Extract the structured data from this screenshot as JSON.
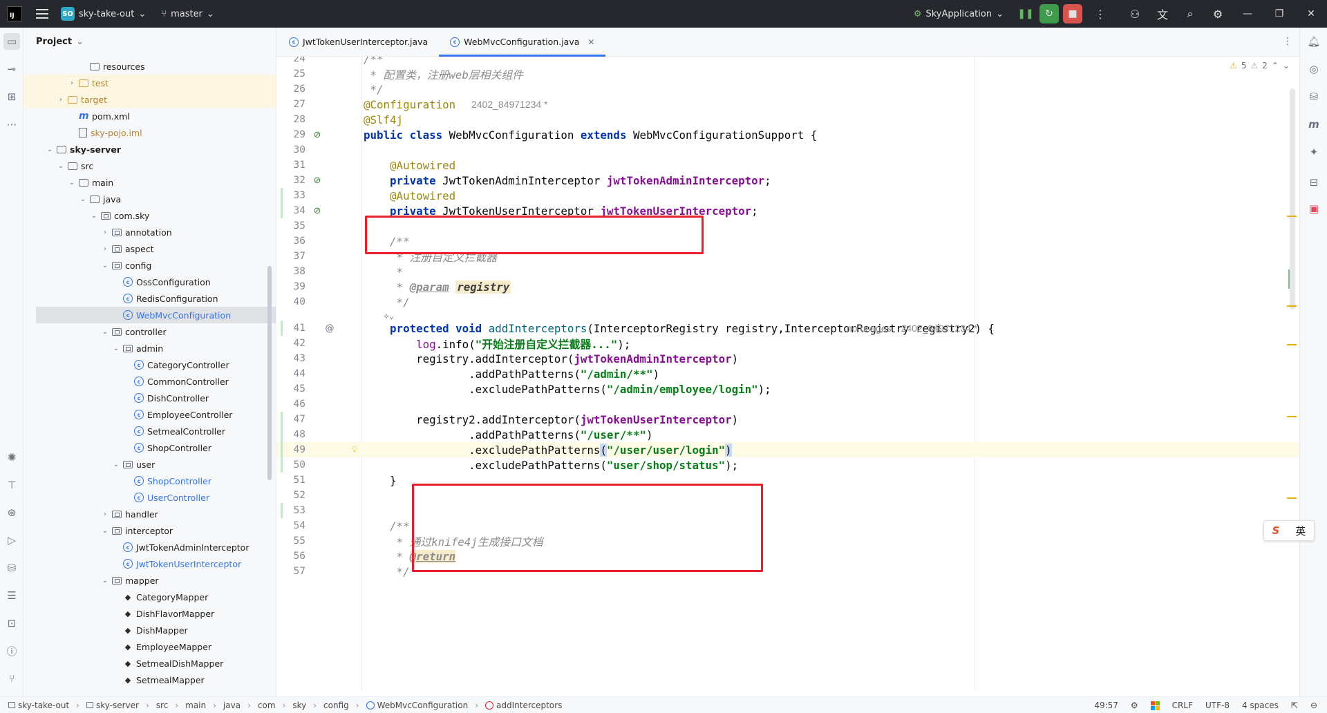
{
  "titlebar": {
    "project_badge": "SO",
    "project_name": "sky-take-out",
    "branch": "master",
    "run_config": "SkyApplication"
  },
  "project_panel": {
    "title": "Project",
    "tree": [
      {
        "label": "resources",
        "depth": 5,
        "arrow": "",
        "icon": "folder-ico",
        "style": ""
      },
      {
        "label": "test",
        "depth": 4,
        "arrow": "›",
        "icon": "folder-ico orange",
        "style": "t-orange",
        "row": "hl-yellow"
      },
      {
        "label": "target",
        "depth": 3,
        "arrow": "›",
        "icon": "folder-ico orange",
        "style": "t-orange",
        "row": "hl-yellow"
      },
      {
        "label": "pom.xml",
        "depth": 4,
        "arrow": "",
        "icon": "m-ico",
        "style": ""
      },
      {
        "label": "sky-pojo.iml",
        "depth": 4,
        "arrow": "",
        "icon": "file-ico",
        "style": "t-orange"
      },
      {
        "label": "sky-server",
        "depth": 2,
        "arrow": "⌄",
        "icon": "folder-ico",
        "style": "t-bold"
      },
      {
        "label": "src",
        "depth": 3,
        "arrow": "⌄",
        "icon": "folder-ico",
        "style": ""
      },
      {
        "label": "main",
        "depth": 4,
        "arrow": "⌄",
        "icon": "folder-ico",
        "style": ""
      },
      {
        "label": "java",
        "depth": 5,
        "arrow": "⌄",
        "icon": "folder-ico",
        "style": ""
      },
      {
        "label": "com.sky",
        "depth": 6,
        "arrow": "⌄",
        "icon": "folder-ico pkg",
        "style": ""
      },
      {
        "label": "annotation",
        "depth": 7,
        "arrow": "›",
        "icon": "folder-ico pkg",
        "style": ""
      },
      {
        "label": "aspect",
        "depth": 7,
        "arrow": "›",
        "icon": "folder-ico pkg",
        "style": ""
      },
      {
        "label": "config",
        "depth": 7,
        "arrow": "⌄",
        "icon": "folder-ico pkg",
        "style": ""
      },
      {
        "label": "OssConfiguration",
        "depth": 8,
        "arrow": "",
        "icon": "class-ico",
        "style": ""
      },
      {
        "label": "RedisConfiguration",
        "depth": 8,
        "arrow": "",
        "icon": "class-ico",
        "style": ""
      },
      {
        "label": "WebMvcConfiguration",
        "depth": 8,
        "arrow": "",
        "icon": "class-ico",
        "style": "t-blue",
        "row": "selected"
      },
      {
        "label": "controller",
        "depth": 7,
        "arrow": "⌄",
        "icon": "folder-ico pkg",
        "style": ""
      },
      {
        "label": "admin",
        "depth": 8,
        "arrow": "⌄",
        "icon": "folder-ico pkg",
        "style": ""
      },
      {
        "label": "CategoryController",
        "depth": 9,
        "arrow": "",
        "icon": "class-ico",
        "style": ""
      },
      {
        "label": "CommonController",
        "depth": 9,
        "arrow": "",
        "icon": "class-ico",
        "style": ""
      },
      {
        "label": "DishController",
        "depth": 9,
        "arrow": "",
        "icon": "class-ico",
        "style": ""
      },
      {
        "label": "EmployeeController",
        "depth": 9,
        "arrow": "",
        "icon": "class-ico",
        "style": ""
      },
      {
        "label": "SetmealController",
        "depth": 9,
        "arrow": "",
        "icon": "class-ico",
        "style": ""
      },
      {
        "label": "ShopController",
        "depth": 9,
        "arrow": "",
        "icon": "class-ico",
        "style": ""
      },
      {
        "label": "user",
        "depth": 8,
        "arrow": "⌄",
        "icon": "folder-ico pkg",
        "style": ""
      },
      {
        "label": "ShopController",
        "depth": 9,
        "arrow": "",
        "icon": "class-ico",
        "style": "t-blue"
      },
      {
        "label": "UserController",
        "depth": 9,
        "arrow": "",
        "icon": "class-ico",
        "style": "t-blue"
      },
      {
        "label": "handler",
        "depth": 7,
        "arrow": "›",
        "icon": "folder-ico pkg",
        "style": ""
      },
      {
        "label": "interceptor",
        "depth": 7,
        "arrow": "⌄",
        "icon": "folder-ico pkg",
        "style": ""
      },
      {
        "label": "JwtTokenAdminInterceptor",
        "depth": 8,
        "arrow": "",
        "icon": "class-ico",
        "style": ""
      },
      {
        "label": "JwtTokenUserInterceptor",
        "depth": 8,
        "arrow": "",
        "icon": "class-ico",
        "style": "t-blue"
      },
      {
        "label": "mapper",
        "depth": 7,
        "arrow": "⌄",
        "icon": "folder-ico pkg",
        "style": ""
      },
      {
        "label": "CategoryMapper",
        "depth": 8,
        "arrow": "",
        "icon": "mapper-ico",
        "style": ""
      },
      {
        "label": "DishFlavorMapper",
        "depth": 8,
        "arrow": "",
        "icon": "mapper-ico",
        "style": ""
      },
      {
        "label": "DishMapper",
        "depth": 8,
        "arrow": "",
        "icon": "mapper-ico",
        "style": ""
      },
      {
        "label": "EmployeeMapper",
        "depth": 8,
        "arrow": "",
        "icon": "mapper-ico",
        "style": ""
      },
      {
        "label": "SetmealDishMapper",
        "depth": 8,
        "arrow": "",
        "icon": "mapper-ico",
        "style": ""
      },
      {
        "label": "SetmealMapper",
        "depth": 8,
        "arrow": "",
        "icon": "mapper-ico",
        "style": ""
      }
    ]
  },
  "tabs": [
    {
      "label": "JwtTokenUserInterceptor.java",
      "active": false
    },
    {
      "label": "WebMvcConfiguration.java",
      "active": true
    }
  ],
  "editor": {
    "inspections": {
      "warnings": "5",
      "weak_warnings": "2"
    },
    "author_hint": "2402_84971234 *",
    "no_usages": "no usages",
    "lines": [
      {
        "n": "24",
        "html": "<span class=\"cm\">/**</span>"
      },
      {
        "n": "25",
        "html": "<span class=\"cm\"> * 配置类，注册web层相关组件</span>"
      },
      {
        "n": "26",
        "html": "<span class=\"cm\"> */</span>"
      },
      {
        "n": "27",
        "html": "<span class=\"ann\">@Configuration</span>",
        "hint": "author"
      },
      {
        "n": "28",
        "html": "<span class=\"ann\">@Slf4j</span>"
      },
      {
        "n": "29",
        "html": "<span class=\"kw\">public class</span> WebMvcConfiguration <span class=\"kw\">extends</span> WebMvcConfigurationSupport {",
        "mark": "bean"
      },
      {
        "n": "30",
        "html": ""
      },
      {
        "n": "31",
        "html": "    <span class=\"ann\">@Autowired</span>"
      },
      {
        "n": "32",
        "html": "    <span class=\"kw\">private</span> JwtTokenAdminInterceptor <span class=\"fld\">jwtTokenAdminInterceptor</span>;",
        "mark": "bean"
      },
      {
        "n": "33",
        "html": "    <span class=\"ann\">@Autowired</span>",
        "changed": true
      },
      {
        "n": "34",
        "html": "    <span class=\"kw\">private</span> JwtTokenUserInterceptor <span class=\"fld\">jwtTokenUserInterceptor</span>;",
        "mark": "bean",
        "changed": true
      },
      {
        "n": "35",
        "html": ""
      },
      {
        "n": "36",
        "html": "    <span class=\"cm\">/**</span>"
      },
      {
        "n": "37",
        "html": "    <span class=\"cm\"> * 注册自定义拦截器</span>"
      },
      {
        "n": "38",
        "html": "    <span class=\"cm\"> *</span>"
      },
      {
        "n": "39",
        "html": "    <span class=\"cm\"> * </span><span class=\"doctag\">@param</span> <span class=\"param\">registry</span>"
      },
      {
        "n": "40",
        "html": "    <span class=\"cm\"> */</span>"
      },
      {
        "n": "",
        "html": "    <span class=\"dim\">⟡⌄</span>",
        "small": true
      },
      {
        "n": "41",
        "html": "    <span class=\"kw\">protected void</span> <span class=\"mth\">addInterceptors</span>(InterceptorRegistry registry,InterceptorRegistry registry2) {",
        "mark": "at",
        "hint": "usages",
        "changed": true
      },
      {
        "n": "42",
        "html": "        <span class=\"fld\" style=\"font-weight:normal\">log</span>.info(<span class=\"str\">\"开始注册自定义拦截器...\"</span>);"
      },
      {
        "n": "43",
        "html": "        registry.addInterceptor(<span class=\"fld\">jwtTokenAdminInterceptor</span>)"
      },
      {
        "n": "44",
        "html": "                .addPathPatterns(<span class=\"str\">\"/admin/**\"</span>)"
      },
      {
        "n": "45",
        "html": "                .excludePathPatterns(<span class=\"str\">\"/admin/employee/login\"</span>);"
      },
      {
        "n": "46",
        "html": ""
      },
      {
        "n": "47",
        "html": "        registry2.addInterceptor(<span class=\"fld\">jwtTokenUserInterceptor</span>)",
        "changed": true
      },
      {
        "n": "48",
        "html": "                .addPathPatterns(<span class=\"str\">\"/user/**\"</span>)",
        "changed": true
      },
      {
        "n": "49",
        "html": "                .excludePathPatterns<span class=\"brace-hl\">(</span><span class=\"str\">\"/user/user/login\"</span><span class=\"brace-hl\">)</span>",
        "mark": "bulb",
        "caret": true,
        "changed": true
      },
      {
        "n": "50",
        "html": "                .excludePathPatterns(<span class=\"str\">\"user/shop/status\"</span>);",
        "changed": true
      },
      {
        "n": "51",
        "html": "    }"
      },
      {
        "n": "52",
        "html": ""
      },
      {
        "n": "53",
        "html": "",
        "changed": true
      },
      {
        "n": "54",
        "html": "    <span class=\"cm\">/**</span>"
      },
      {
        "n": "55",
        "html": "    <span class=\"cm\"> * 通过knife4j生成接口文档</span>"
      },
      {
        "n": "56",
        "html": "    <span class=\"cm\"> * </span><span class=\"doctag\" style=\"background:#f6eccc\">@return</span>"
      },
      {
        "n": "57",
        "html": "    <span class=\"cm\"> */</span>"
      }
    ]
  },
  "ime": {
    "brand": "S",
    "mode": "英"
  },
  "statusbar": {
    "breadcrumbs": [
      "sky-take-out",
      "sky-server",
      "src",
      "main",
      "java",
      "com",
      "sky",
      "config",
      "WebMvcConfiguration",
      "addInterceptors"
    ],
    "position": "49:57",
    "line_sep": "CRLF",
    "encoding": "UTF-8",
    "indent": "4 spaces"
  }
}
